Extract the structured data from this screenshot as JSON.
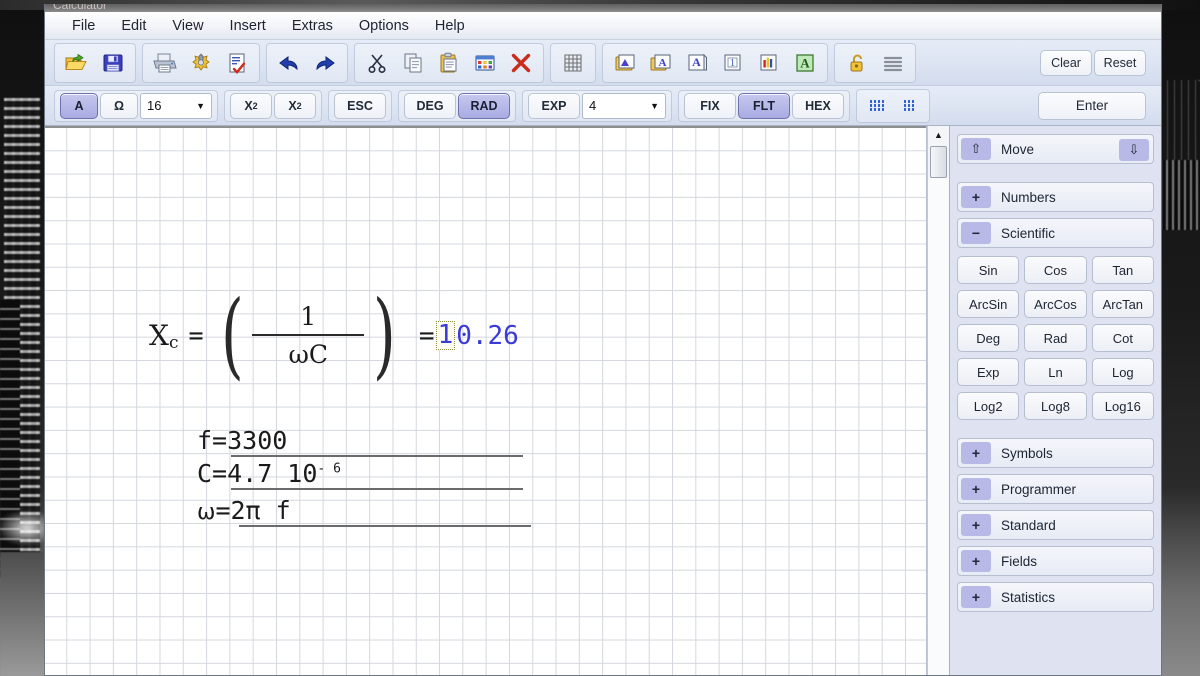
{
  "window": {
    "title": "Calculator"
  },
  "menu": {
    "items": [
      {
        "label": "File"
      },
      {
        "label": "Edit"
      },
      {
        "label": "View"
      },
      {
        "label": "Insert"
      },
      {
        "label": "Extras"
      },
      {
        "label": "Options"
      },
      {
        "label": "Help"
      }
    ]
  },
  "toolbar_main": {
    "groups": [
      {
        "buttons": [
          {
            "name": "open-icon",
            "title": "Open"
          },
          {
            "name": "save-icon",
            "title": "Save"
          }
        ]
      },
      {
        "buttons": [
          {
            "name": "print-icon",
            "title": "Print"
          },
          {
            "name": "print-setup-icon",
            "title": "Print Setup"
          },
          {
            "name": "print-preview-icon",
            "title": "Print Preview"
          }
        ]
      },
      {
        "buttons": [
          {
            "name": "undo-icon",
            "title": "Undo"
          },
          {
            "name": "redo-icon",
            "title": "Redo"
          }
        ]
      },
      {
        "buttons": [
          {
            "name": "cut-icon",
            "title": "Cut"
          },
          {
            "name": "copy-icon",
            "title": "Copy"
          },
          {
            "name": "paste-icon",
            "title": "Paste"
          },
          {
            "name": "paste-table-icon",
            "title": "Paste Table"
          },
          {
            "name": "delete-icon",
            "title": "Delete"
          }
        ]
      },
      {
        "buttons": [
          {
            "name": "grid-icon",
            "title": "Grid"
          }
        ]
      },
      {
        "buttons": [
          {
            "name": "insert-graphic-icon",
            "title": "Insert Graphic"
          },
          {
            "name": "insert-text-icon",
            "title": "Insert Text"
          },
          {
            "name": "text-box-icon",
            "title": "Text Box"
          },
          {
            "name": "number-box-icon",
            "title": "Number Box"
          },
          {
            "name": "chart-icon",
            "title": "Chart"
          },
          {
            "name": "green-text-icon",
            "title": "Text Field"
          }
        ]
      },
      {
        "buttons": [
          {
            "name": "lock-icon",
            "title": "Lock"
          },
          {
            "name": "lines-icon",
            "title": "Lines"
          }
        ]
      }
    ],
    "clear_label": "Clear",
    "reset_label": "Reset"
  },
  "toolbar_secondary": {
    "font_button": "A",
    "omega_button": "Ω",
    "font_size": {
      "value": "16"
    },
    "superscript": "X",
    "superscript_exp": "2",
    "subscript": "X",
    "subscript_idx": "2",
    "esc_label": "ESC",
    "deg_label": "DEG",
    "rad_label": "RAD",
    "exp_label": "EXP",
    "precision": {
      "value": "4"
    },
    "fix_label": "FIX",
    "flt_label": "FLT",
    "hex_label": "HEX",
    "dots_small_icon": "dot-grid-small-icon",
    "dots_large_icon": "dot-grid-large-icon",
    "enter_label": "Enter",
    "active": [
      "A",
      "RAD",
      "FLT"
    ]
  },
  "canvas": {
    "equation": {
      "variable": "X",
      "variable_index": "c",
      "equals": "=",
      "numerator": "1",
      "denominator": "ωC",
      "result_equals": "=",
      "result_selected_digit": "1",
      "result_rest": "0.26",
      "result_full": "10.26",
      "result_color": "#3a3ad8"
    },
    "definitions": [
      {
        "name": "f-definition",
        "text": "f=3300"
      },
      {
        "name": "c-definition",
        "prefix": "C=4.7 10",
        "exponent": "- 6"
      },
      {
        "name": "omega-definition",
        "greek": "ω",
        "text": "=2π f"
      }
    ]
  },
  "side_panel": {
    "move": {
      "label": "Move",
      "up_icon": "arrow-up-icon",
      "down_icon": "arrow-down-icon"
    },
    "sections": [
      {
        "label": "Numbers",
        "state": "+"
      },
      {
        "label": "Scientific",
        "state": "−"
      }
    ],
    "scientific_buttons": [
      "Sin",
      "Cos",
      "Tan",
      "ArcSin",
      "ArcCos",
      "ArcTan",
      "Deg",
      "Rad",
      "Cot",
      "Exp",
      "Ln",
      "Log",
      "Log2",
      "Log8",
      "Log16"
    ],
    "collapsed_sections": [
      {
        "label": "Symbols",
        "state": "+"
      },
      {
        "label": "Programmer",
        "state": "+"
      },
      {
        "label": "Standard",
        "state": "+"
      },
      {
        "label": "Fields",
        "state": "+"
      },
      {
        "label": "Statistics",
        "state": "+"
      }
    ]
  },
  "scrollbar": {
    "up_arrow": "▲",
    "name": "vertical-scrollbar"
  },
  "colors": {
    "accent": "#a8abe2",
    "result_blue": "#3a3ad8",
    "panel_bg": "#dfe2f1",
    "toolbar_bg": "#dde5f3"
  }
}
